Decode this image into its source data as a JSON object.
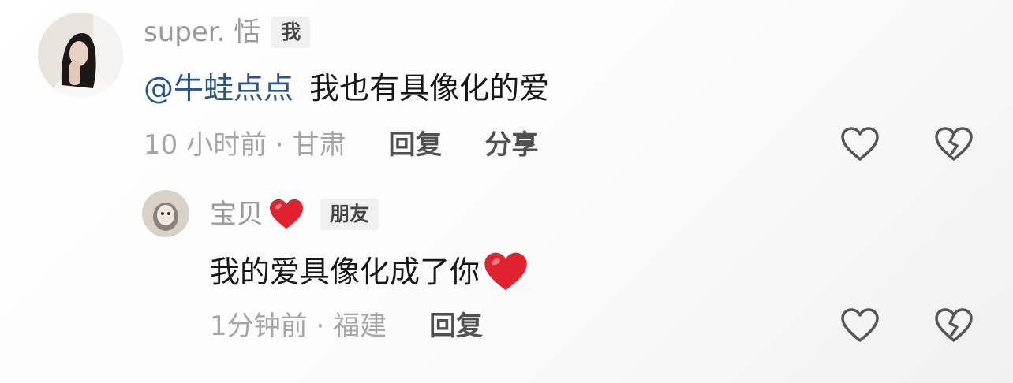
{
  "comments": [
    {
      "username": "super. 恬",
      "tag": "我",
      "mention": "@牛蛙点点",
      "text": "我也有具像化的爱",
      "meta": "10 小时前 · 甘肃",
      "reply_label": "回复",
      "share_label": "分享"
    },
    {
      "username": "宝贝",
      "username_emoji": "heart-emoji",
      "tag": "朋友",
      "text": "我的爱具像化成了你",
      "text_emoji": "heart-emoji",
      "meta": "1分钟前 · 福建",
      "reply_label": "回复"
    }
  ],
  "icons": {
    "like": "heart-outline-icon",
    "dislike": "broken-heart-icon"
  },
  "colors": {
    "mention": "#2d5487",
    "meta": "#a6a6a6",
    "username": "#9a9a9a",
    "emoji_heart": "#e0222f"
  }
}
